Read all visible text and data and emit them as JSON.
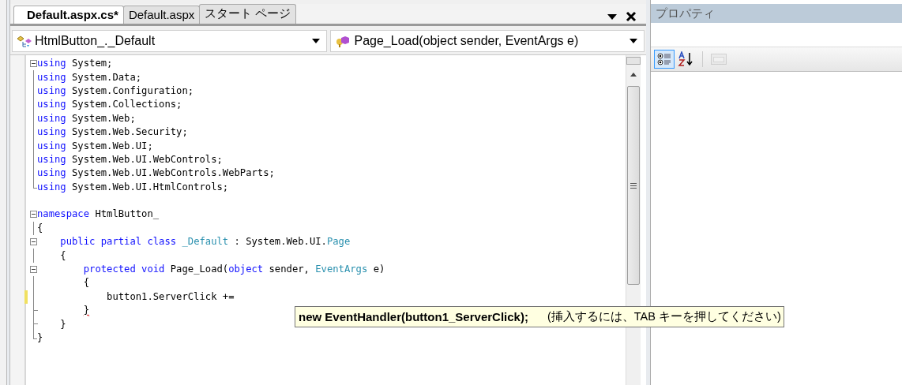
{
  "editor": {
    "tabs": [
      {
        "label": "Default.aspx.cs*",
        "selected": true
      },
      {
        "label": "Default.aspx",
        "selected": false
      },
      {
        "label": "スタート ページ",
        "selected": false
      }
    ],
    "class_dropdown": {
      "value": "HtmlButton_._Default"
    },
    "member_dropdown": {
      "value": "Page_Load(object sender, EventArgs e)"
    },
    "lines": [
      {
        "kind": "collapse",
        "changed": false,
        "tokens": [
          {
            "text": "using",
            "kind": "keyword"
          },
          {
            "text": " System;",
            "kind": "plain"
          }
        ]
      },
      {
        "kind": "line",
        "changed": false,
        "tokens": [
          {
            "text": "using",
            "kind": "keyword"
          },
          {
            "text": " System.Data;",
            "kind": "plain"
          }
        ]
      },
      {
        "kind": "line",
        "changed": false,
        "tokens": [
          {
            "text": "using",
            "kind": "keyword"
          },
          {
            "text": " System.Configuration;",
            "kind": "plain"
          }
        ]
      },
      {
        "kind": "line",
        "changed": false,
        "tokens": [
          {
            "text": "using",
            "kind": "keyword"
          },
          {
            "text": " System.Collections;",
            "kind": "plain"
          }
        ]
      },
      {
        "kind": "line",
        "changed": false,
        "tokens": [
          {
            "text": "using",
            "kind": "keyword"
          },
          {
            "text": " System.Web;",
            "kind": "plain"
          }
        ]
      },
      {
        "kind": "line",
        "changed": false,
        "tokens": [
          {
            "text": "using",
            "kind": "keyword"
          },
          {
            "text": " System.Web.Security;",
            "kind": "plain"
          }
        ]
      },
      {
        "kind": "line",
        "changed": false,
        "tokens": [
          {
            "text": "using",
            "kind": "keyword"
          },
          {
            "text": " System.Web.UI;",
            "kind": "plain"
          }
        ]
      },
      {
        "kind": "line",
        "changed": false,
        "tokens": [
          {
            "text": "using",
            "kind": "keyword"
          },
          {
            "text": " System.Web.UI.WebControls;",
            "kind": "plain"
          }
        ]
      },
      {
        "kind": "line",
        "changed": false,
        "tokens": [
          {
            "text": "using",
            "kind": "keyword"
          },
          {
            "text": " System.Web.UI.WebControls.WebParts;",
            "kind": "plain"
          }
        ]
      },
      {
        "kind": "end",
        "changed": false,
        "tokens": [
          {
            "text": "using",
            "kind": "keyword"
          },
          {
            "text": " System.Web.UI.HtmlControls;",
            "kind": "plain"
          }
        ]
      },
      {
        "kind": "blank",
        "changed": false
      },
      {
        "kind": "collapse",
        "changed": false,
        "tokens": [
          {
            "text": "namespace",
            "kind": "keyword"
          },
          {
            "text": " HtmlButton_",
            "kind": "plain"
          }
        ]
      },
      {
        "kind": "line",
        "changed": false,
        "tokens": [
          {
            "text": "{",
            "kind": "plain"
          }
        ]
      },
      {
        "kind": "collapse",
        "changed": false,
        "tokens": [
          {
            "text": "    public partial class",
            "kind": "keyword"
          },
          {
            "text": " _Default",
            "kind": "type"
          },
          {
            "text": " : System.Web.UI.",
            "kind": "plain"
          },
          {
            "text": "Page",
            "kind": "type"
          }
        ]
      },
      {
        "kind": "line",
        "changed": false,
        "tokens": [
          {
            "text": "    {",
            "kind": "plain"
          }
        ]
      },
      {
        "kind": "collapse",
        "changed": false,
        "tokens": [
          {
            "text": "        protected void",
            "kind": "keyword"
          },
          {
            "text": " Page_Load(",
            "kind": "plain"
          },
          {
            "text": "object",
            "kind": "keyword"
          },
          {
            "text": " sender, ",
            "kind": "plain"
          },
          {
            "text": "EventArgs",
            "kind": "type"
          },
          {
            "text": " e)",
            "kind": "plain"
          }
        ]
      },
      {
        "kind": "line",
        "changed": false,
        "tokens": [
          {
            "text": "        {",
            "kind": "plain"
          }
        ]
      },
      {
        "kind": "line",
        "changed": true,
        "tokens": [
          {
            "text": "            button1.ServerClick +=",
            "kind": "plain"
          }
        ]
      },
      {
        "kind": "tick",
        "changed": false,
        "tokens": [
          {
            "text": "        }",
            "kind": "error"
          }
        ]
      },
      {
        "kind": "tick",
        "changed": false,
        "tokens": [
          {
            "text": "    }",
            "kind": "plain"
          }
        ]
      },
      {
        "kind": "end",
        "changed": false,
        "tokens": [
          {
            "text": "}",
            "kind": "plain"
          }
        ]
      }
    ],
    "tooltip": {
      "code": "new EventHandler(button1_ServerClick);",
      "hint": "(挿入するには、TAB キーを押してください)"
    }
  },
  "properties": {
    "title": "プロパティ",
    "toolbar": [
      {
        "kind": "categorized",
        "selected": true,
        "disabled": false
      },
      {
        "kind": "alphabetical",
        "selected": false,
        "disabled": false
      },
      {
        "kind": "pages",
        "selected": false,
        "disabled": true
      }
    ]
  }
}
